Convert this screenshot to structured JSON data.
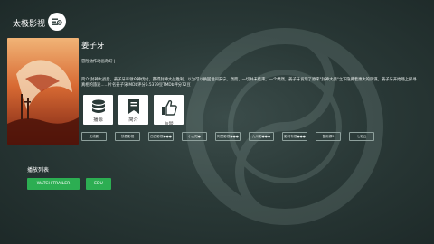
{
  "app": {
    "title": "太极影视"
  },
  "detail": {
    "title": "姜子牙",
    "meta": "冒险动作动画奇幻 |",
    "description": "简介:封神大战后，姜子牙率领众神伐纣，赢得封神大战胜利，以为可以换回世间安宁。然而，一切并未结束。一个偶然，姜子牙发现了原来\"封神大战\"之下隐藏着更大的阴谋。姜子牙开始踏上探寻真相的旅途......片名姜子牙IMDb评分6.5379豆TMDb评分72豆"
  },
  "actions": [
    {
      "label": "播源",
      "icon": "database-icon"
    },
    {
      "label": "简介",
      "icon": "document-icon"
    },
    {
      "label": "点赞",
      "icon": "thumbs-up-icon"
    }
  ],
  "sources": [
    "无线影",
    "快看影视",
    "西西影视●●●",
    "小太阳●",
    "阿里影视●●●",
    "九州影●●●",
    "影其有视●●●",
    "备用源2",
    "七彩云"
  ],
  "playlist": {
    "title": "播放列表",
    "episodes": [
      "WATCH TRAILER",
      "EDU"
    ]
  },
  "colors": {
    "accent": "#2cae52",
    "background": "#2a3937",
    "tile": "#ffffff"
  }
}
